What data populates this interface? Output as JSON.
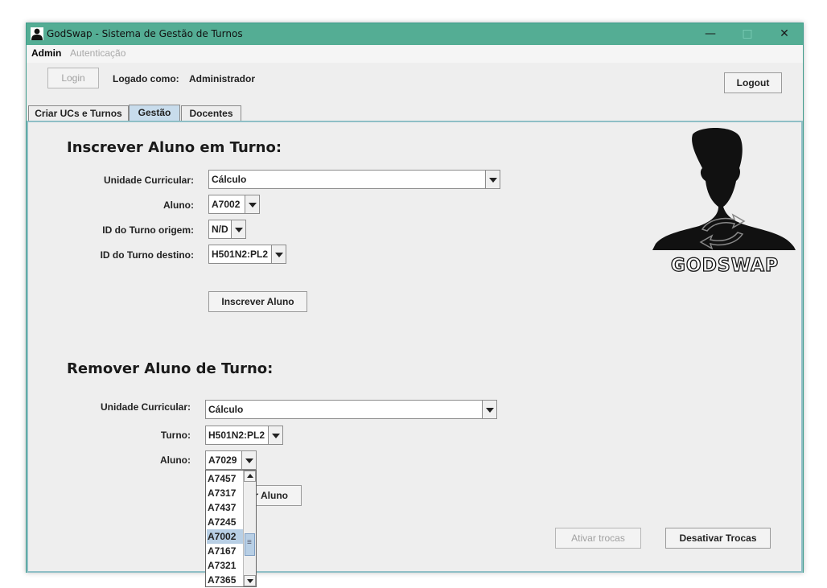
{
  "window": {
    "title": "GodSwap - Sistema de Gestão de Turnos",
    "controls": {
      "minimize": "—",
      "maximize": "□",
      "close": "✕"
    }
  },
  "menubar": {
    "items": [
      "Admin",
      "Autenticação"
    ]
  },
  "header": {
    "login_label": "Login",
    "logged_as_label": "Logado como:",
    "user_name": "Administrador",
    "logout_label": "Logout"
  },
  "tabs": [
    {
      "label": "Criar UCs e Turnos",
      "active": false
    },
    {
      "label": "Gestão",
      "active": true
    },
    {
      "label": "Docentes",
      "active": false
    }
  ],
  "enroll": {
    "heading": "Inscrever Aluno em Turno:",
    "uc_label": "Unidade Curricular:",
    "uc_value": "Cálculo",
    "student_label": "Aluno:",
    "student_value": "A7002",
    "origin_label": "ID do Turno origem:",
    "origin_value": "N/D",
    "dest_label": "ID do Turno destino:",
    "dest_value": "H501N2:PL2",
    "button_label": "Inscrever Aluno"
  },
  "remove": {
    "heading": "Remover Aluno de Turno:",
    "uc_label": "Unidade Curricular:",
    "uc_value": "Cálculo",
    "shift_label": "Turno:",
    "shift_value": "H501N2:PL2",
    "student_label": "Aluno:",
    "student_value": "A7029",
    "button_label_partial": "r Aluno",
    "dropdown_items": [
      "A7457",
      "A7317",
      "A7437",
      "A7245",
      "A7002",
      "A7167",
      "A7321",
      "A7365"
    ],
    "dropdown_selected": "A7002"
  },
  "swaps": {
    "activate_label": "Ativar trocas",
    "deactivate_label": "Desativar Trocas"
  },
  "logo": {
    "text": "GODSWAP",
    "icon": "person-silhouette-with-swap-arrows"
  },
  "colors": {
    "titlebar": "#54ad94",
    "active_tab": "#c8dcec",
    "selection": "#b8cfe5"
  }
}
